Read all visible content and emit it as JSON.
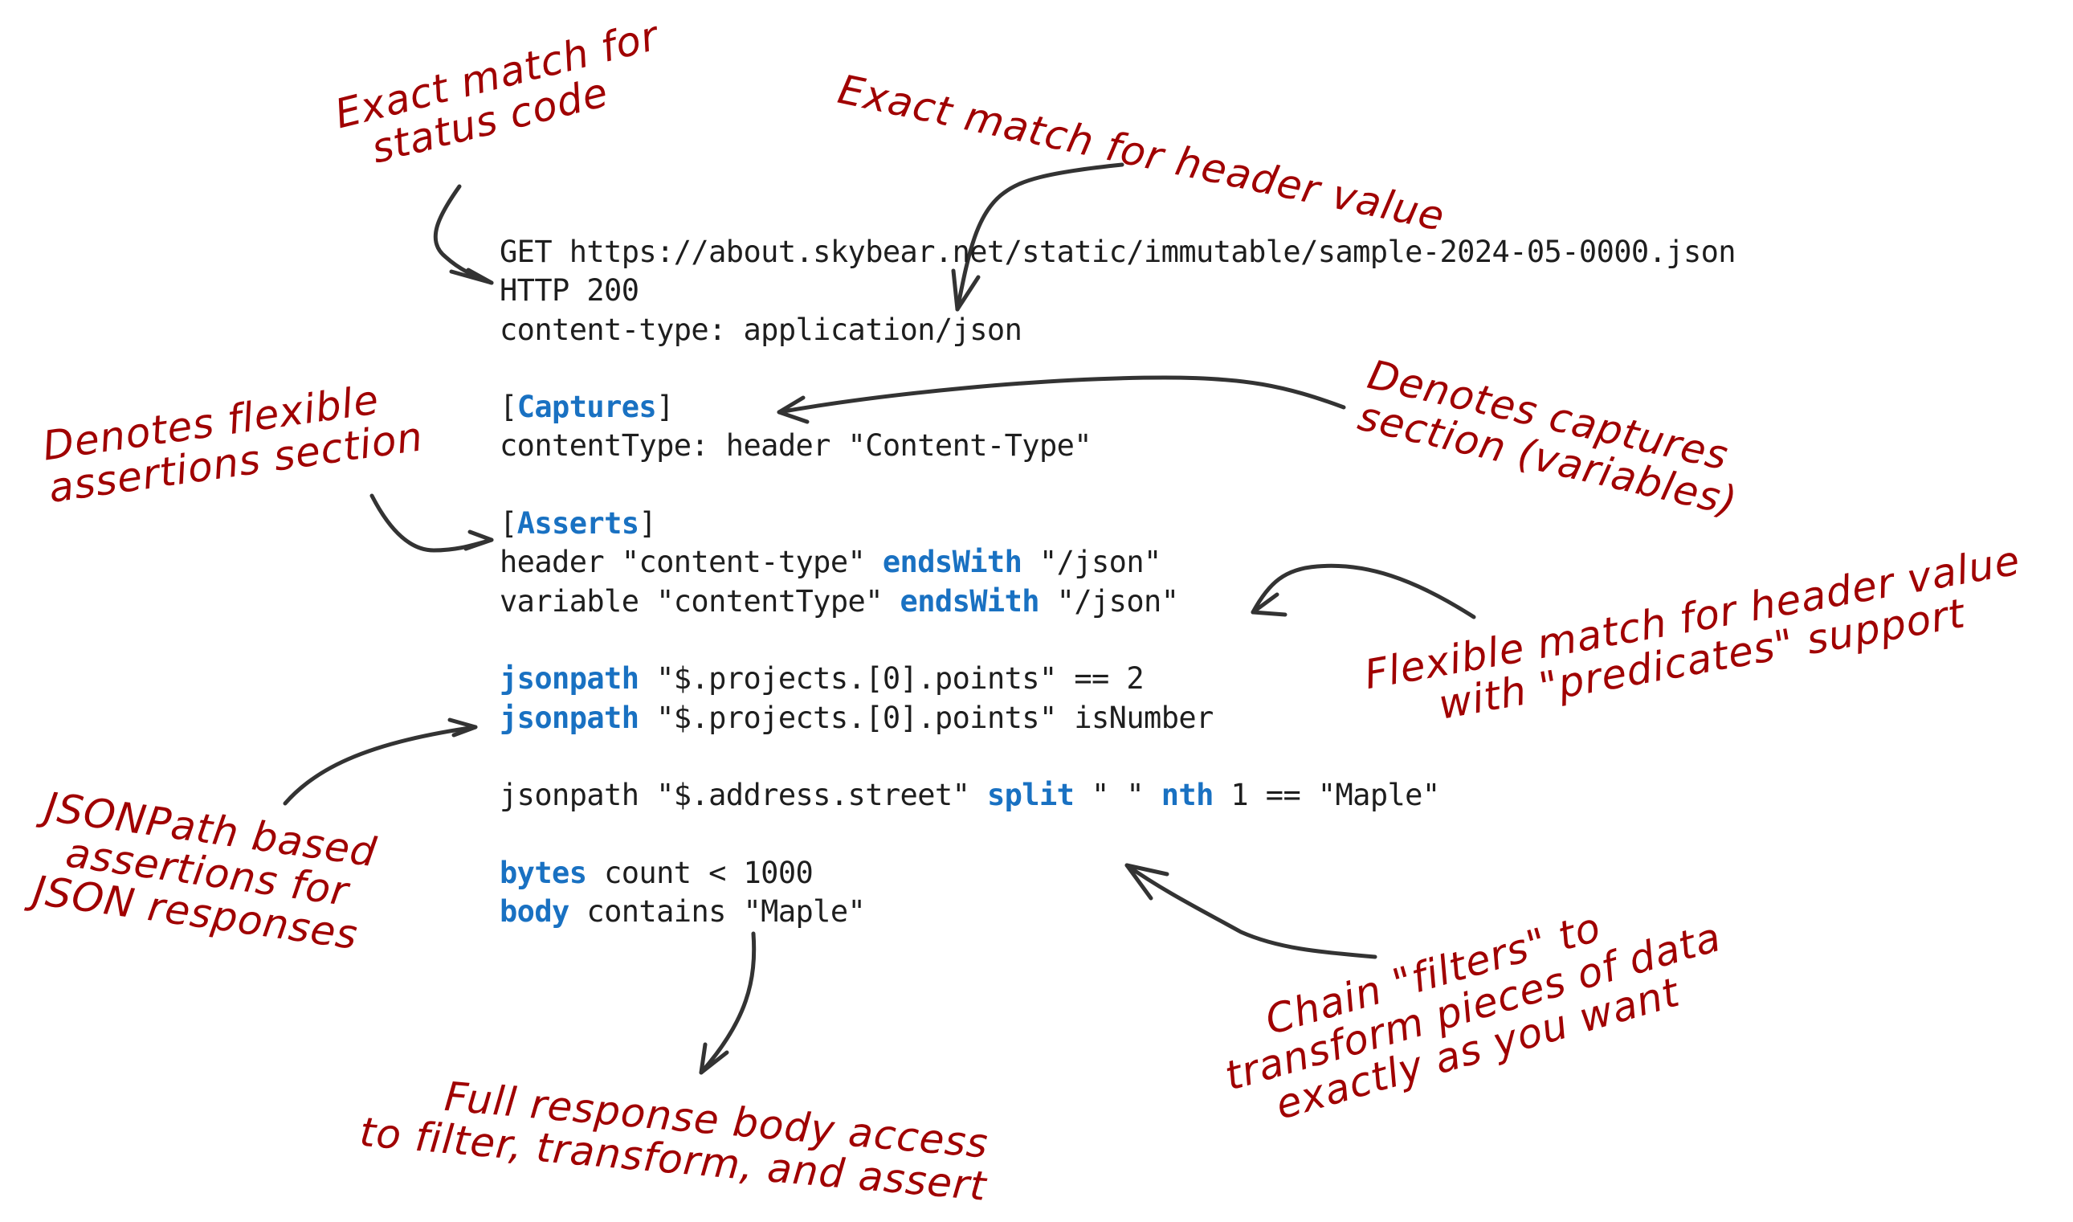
{
  "code_block": {
    "lines": [
      [
        {
          "t": "GET https://about.skybear.net/static/immutable/sample-2024-05-0000.json",
          "k": false
        }
      ],
      [
        {
          "t": "HTTP 200",
          "k": false
        }
      ],
      [
        {
          "t": "content-type: application/json",
          "k": false
        }
      ],
      [],
      [
        {
          "t": "[",
          "k": false
        },
        {
          "t": "Captures",
          "k": true
        },
        {
          "t": "]",
          "k": false
        }
      ],
      [
        {
          "t": "contentType: header \"Content-Type\"",
          "k": false
        }
      ],
      [],
      [
        {
          "t": "[",
          "k": false
        },
        {
          "t": "Asserts",
          "k": true
        },
        {
          "t": "]",
          "k": false
        }
      ],
      [
        {
          "t": "header \"content-type\" ",
          "k": false
        },
        {
          "t": "endsWith",
          "k": true
        },
        {
          "t": " \"/json\"",
          "k": false
        }
      ],
      [
        {
          "t": "variable \"contentType\" ",
          "k": false
        },
        {
          "t": "endsWith",
          "k": true
        },
        {
          "t": " \"/json\"",
          "k": false
        }
      ],
      [],
      [
        {
          "t": "jsonpath",
          "k": true
        },
        {
          "t": " \"$.projects.[0].points\" == 2",
          "k": false
        }
      ],
      [
        {
          "t": "jsonpath",
          "k": true
        },
        {
          "t": " \"$.projects.[0].points\" isNumber",
          "k": false
        }
      ],
      [],
      [
        {
          "t": "jsonpath \"$.address.street\" ",
          "k": false
        },
        {
          "t": "split",
          "k": true
        },
        {
          "t": " \" \" ",
          "k": false
        },
        {
          "t": "nth",
          "k": true
        },
        {
          "t": " 1 == \"Maple\"",
          "k": false
        }
      ],
      [],
      [
        {
          "t": "bytes",
          "k": true
        },
        {
          "t": " count < 1000",
          "k": false
        }
      ],
      [
        {
          "t": "body",
          "k": true
        },
        {
          "t": " contains \"Maple\"",
          "k": false
        }
      ]
    ]
  },
  "annotations": {
    "status_code": "Exact match for\n  status code",
    "header_value": "Exact match for header value",
    "captures": "Denotes captures\nsection (variables)",
    "asserts": "Denotes flexible\nassertions section",
    "predicates": "Flexible match for header value\n     with \"predicates\" support",
    "jsonpath": "JSONPath based\n  assertions for\nJSON responses",
    "filters": "    Chain \"filters\" to\ntransform pieces of data\n   exactly as you want",
    "body": "      Full response body access\nto filter, transform, and assert"
  },
  "colors": {
    "annotation": "#a00000",
    "keyword": "#1971c2",
    "text": "#1e1e1e",
    "arrow": "#333333"
  }
}
